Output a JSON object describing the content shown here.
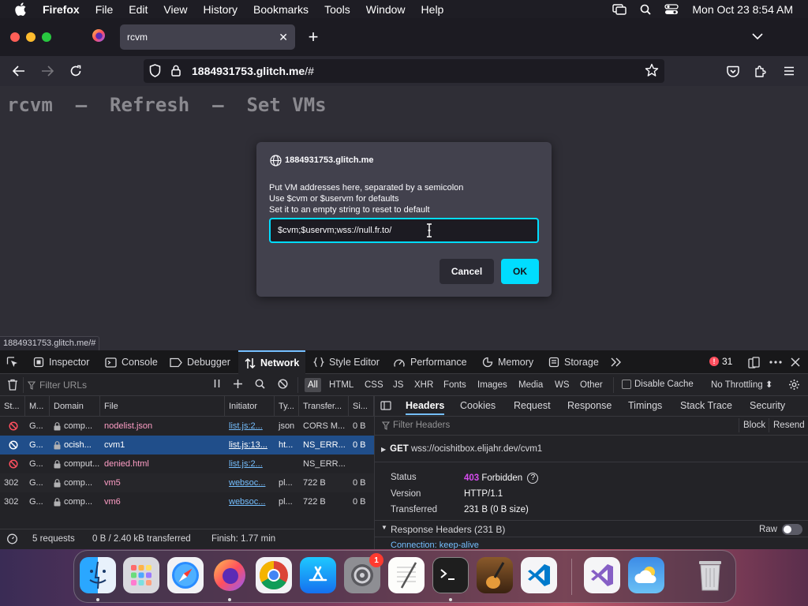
{
  "menubar": {
    "app_name": "Firefox",
    "items": [
      "File",
      "Edit",
      "View",
      "History",
      "Bookmarks",
      "Tools",
      "Window",
      "Help"
    ],
    "clock": "Mon Oct 23  8:54 AM"
  },
  "tabs": {
    "active_title": "rcvm",
    "close_glyph": "✕",
    "new_tab_glyph": "+"
  },
  "navbar": {
    "url_host": "1884931753.glitch.me",
    "url_path": "/#"
  },
  "page": {
    "heading_parts": [
      "rcvm",
      "  –  ",
      "Refresh",
      "  –  ",
      "Set VMs"
    ],
    "status_url": "1884931753.glitch.me/#"
  },
  "dialog": {
    "title": "1884931753.glitch.me",
    "message_lines": [
      "Put VM addresses here, separated by a semicolon",
      "Use $cvm or $uservm for defaults",
      "Set it to an empty string to reset to default"
    ],
    "input_value": "$cvm;$uservm;wss://null.fr.to/",
    "cancel_label": "Cancel",
    "ok_label": "OK"
  },
  "devtools": {
    "tabs": [
      "Inspector",
      "Console",
      "Debugger",
      "Network",
      "Style Editor",
      "Performance",
      "Memory",
      "Storage"
    ],
    "selected_tab": "Network",
    "error_count": "31",
    "filter_placeholder": "Filter URLs",
    "filter_types": [
      "All",
      "HTML",
      "CSS",
      "JS",
      "XHR",
      "Fonts",
      "Images",
      "Media",
      "WS",
      "Other"
    ],
    "selected_filter": "All",
    "disable_cache_label": "Disable Cache",
    "throttling_label": "No Throttling ⬍",
    "columns": [
      "St...",
      "M...",
      "Domain",
      "File",
      "Initiator",
      "Ty...",
      "Transfer...",
      "Si..."
    ],
    "requests": [
      {
        "status": "blocked",
        "method": "G...",
        "domain": "comp...",
        "file": "nodelist.json",
        "initiator": "list.js:2...",
        "type": "json",
        "transferred": "CORS M...",
        "size": "0 B"
      },
      {
        "status": "blocked",
        "method": "G...",
        "domain": "ocish...",
        "file": "cvm1",
        "initiator": "list.js:13...",
        "type": "ht...",
        "transferred": "NS_ERR...",
        "size": "0 B"
      },
      {
        "status": "blocked",
        "method": "G...",
        "domain": "comput...",
        "file": "denied.html",
        "initiator": "list.js:2...",
        "type": "",
        "transferred": "NS_ERR...",
        "size": ""
      },
      {
        "status": "302",
        "method": "G...",
        "domain": "comp...",
        "file": "vm5",
        "initiator": "websoc...",
        "type": "pl...",
        "transferred": "722 B",
        "size": "0 B"
      },
      {
        "status": "302",
        "method": "G...",
        "domain": "comp...",
        "file": "vm6",
        "initiator": "websoc...",
        "type": "pl...",
        "transferred": "722 B",
        "size": "0 B"
      }
    ],
    "selected_request_index": 1,
    "summary": {
      "requests": "5 requests",
      "transferred": "0 B / 2.40 kB transferred",
      "finish": "Finish: 1.77 min"
    },
    "side_tabs": [
      "Headers",
      "Cookies",
      "Request",
      "Response",
      "Timings",
      "Stack Trace",
      "Security"
    ],
    "selected_side_tab": "Headers",
    "filter_headers_placeholder": "Filter Headers",
    "block_label": "Block",
    "resend_label": "Resend",
    "request_method": "GET",
    "request_url": "wss://ocishitbox.elijahr.dev/cvm1",
    "details": [
      {
        "key": "Status",
        "value": "403 Forbidden"
      },
      {
        "key": "Version",
        "value": "HTTP/1.1"
      },
      {
        "key": "Transferred",
        "value": "231 B (0 B size)"
      }
    ],
    "response_headers_label": "Response Headers (231 B)",
    "raw_label": "Raw",
    "partial_header": "Connection: keep-alive"
  },
  "dock": {
    "apps": [
      "Finder",
      "Launchpad",
      "Safari",
      "Firefox",
      "Chrome",
      "App Store",
      "System Settings",
      "TextEdit",
      "Terminal",
      "GarageBand",
      "Visual Studio Code",
      "Visual Studio",
      "Weather",
      "Trash"
    ],
    "settings_badge": "1"
  },
  "colors": {
    "accent": "#00ddff",
    "status_403": "#d74cf0",
    "selected_row": "#204e8a",
    "error_red": "#ff4f5e"
  }
}
